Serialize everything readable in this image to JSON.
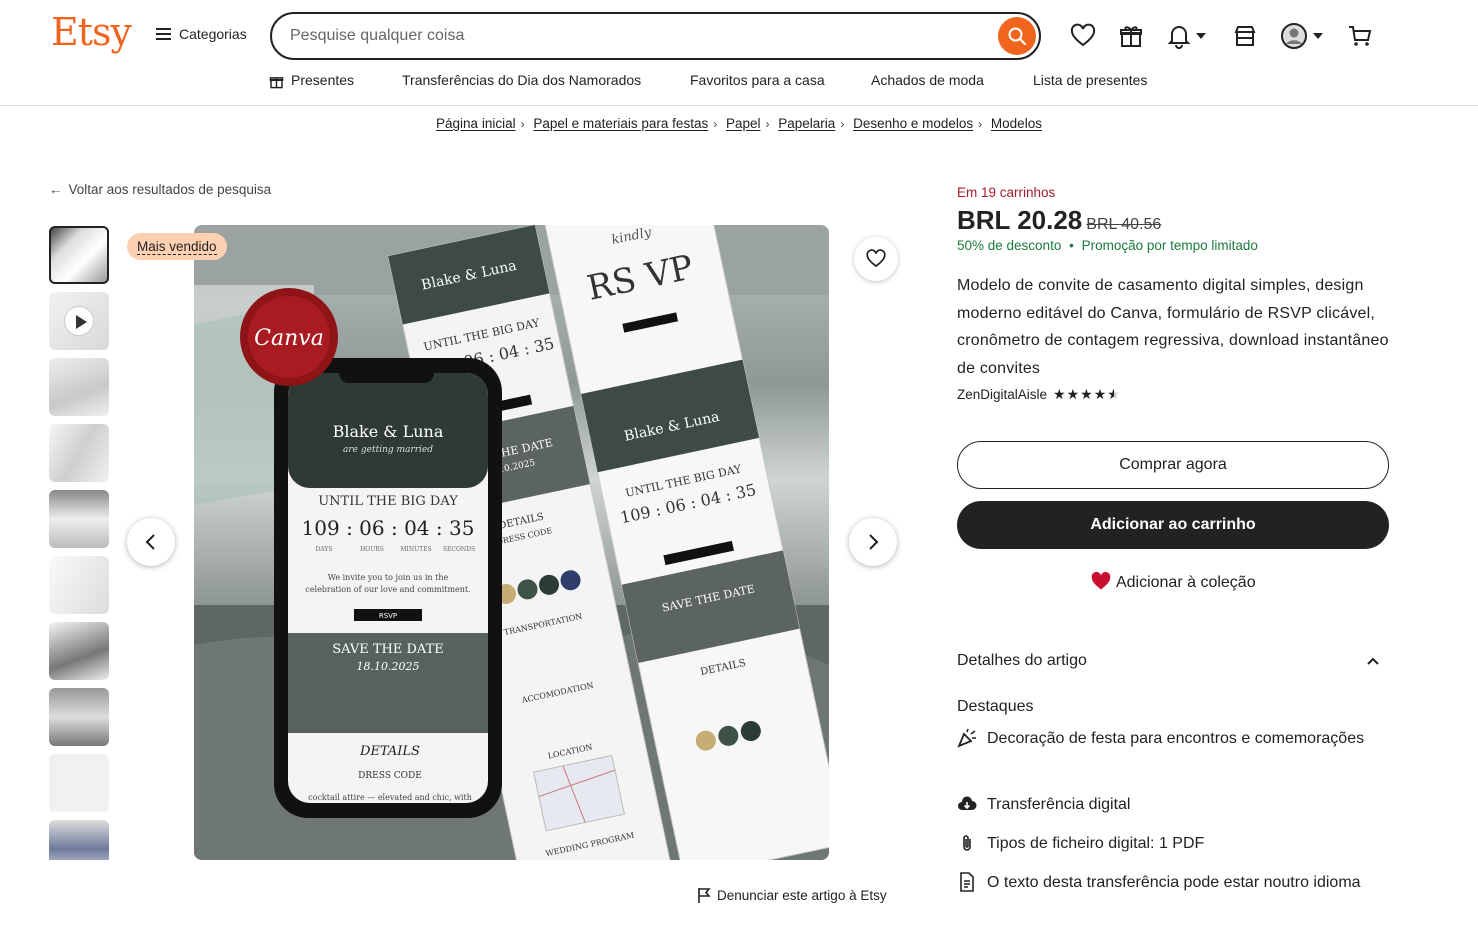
{
  "header": {
    "logo": "Etsy",
    "categories_label": "Categorias",
    "search_placeholder": "Pesquise qualquer coisa"
  },
  "nav": {
    "items": [
      "Presentes",
      "Transferências do Dia dos Namorados",
      "Favoritos para a casa",
      "Achados de moda",
      "Lista de presentes"
    ]
  },
  "breadcrumb": [
    "Página inicial",
    "Papel e materiais para festas",
    "Papel",
    "Papelaria",
    "Desenho e modelos",
    "Modelos"
  ],
  "back_link": "Voltar aos resultados de pesquisa",
  "badge": "Mais vendido",
  "report_link": "Denunciar este artigo à Etsy",
  "product": {
    "in_carts": "Em 19 carrinhos",
    "price": "BRL 20.28",
    "old_price": "BRL 40.56",
    "discount": "50% de desconto",
    "promo": "Promoção por tempo limitado",
    "title": "Modelo de convite de casamento digital simples, design moderno editável do Canva, formulário de RSVP clicável, cronômetro de contagem regressiva, download instantâneo de convites",
    "shop": "ZenDigitalAisle",
    "rating_stars": 4.5,
    "buy_now": "Comprar agora",
    "add_to_cart": "Adicionar ao carrinho",
    "add_collection": "Adicionar à coleção",
    "details_heading": "Detalhes do artigo",
    "highlights_heading": "Destaques",
    "highlights": [
      "Decoração de festa para encontros e comemorações",
      "Transferência digital",
      "Tipos de ficheiro digital: 1 PDF",
      "O texto desta transferência pode estar noutro idioma"
    ]
  },
  "image": {
    "canva_seal": "Canva",
    "couple": "Blake & Luna",
    "tagline": "are getting married",
    "countdown_title": "UNTIL THE BIG DAY",
    "countdown": "109 : 06 : 04 : 35",
    "units": [
      "DAYS",
      "HOURS",
      "MINUTES",
      "SECONDS"
    ],
    "invite": "We invite you to join us in the celebration of our love and commitment.",
    "rsvp_btn": "RSVP",
    "save_date": "SAVE THE DATE",
    "date": "18.10.2025",
    "details": "DETAILS",
    "dress_code": "DRESS CODE",
    "dress_text": "cocktail attire — elevated and chic, with",
    "kindly": "kindly",
    "rsvp_big": "RS VP",
    "transport": "TRANSPORTATION",
    "accom": "ACCOMODATION",
    "location": "LOCATION",
    "program": "WEDDING PROGRAM"
  }
}
